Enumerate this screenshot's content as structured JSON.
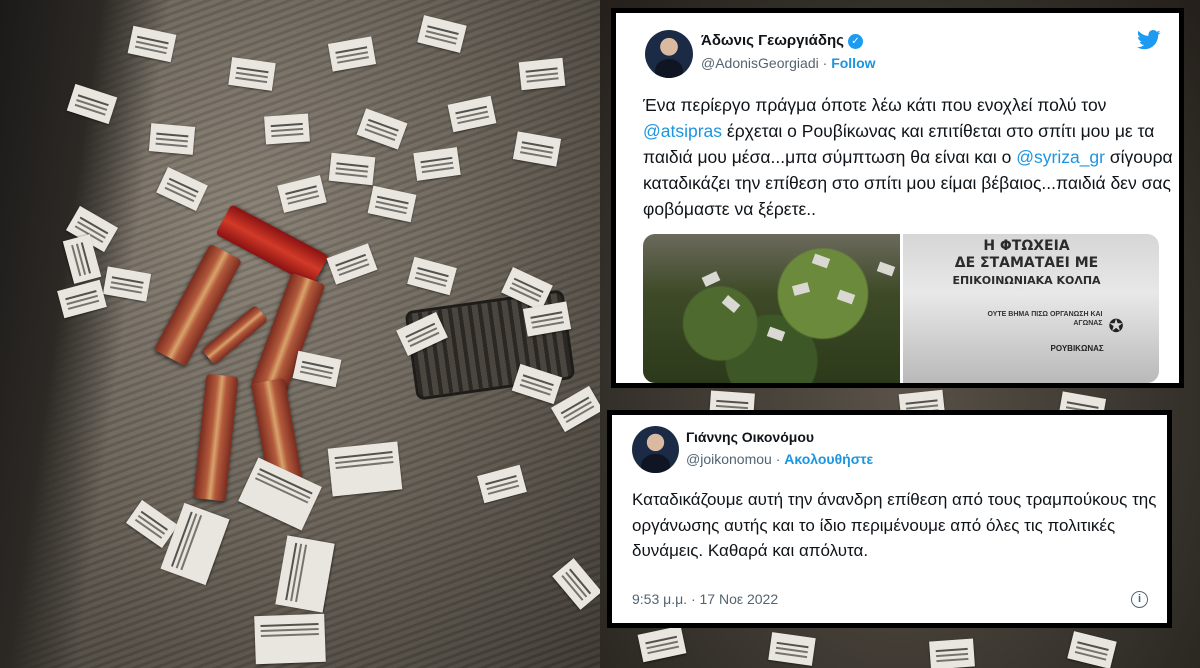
{
  "tweet_1": {
    "author_name": "Άδωνις Γεωργιάδης",
    "handle": "@AdonisGeorgiadi",
    "separator": "·",
    "follow_label": "Follow",
    "text_parts": {
      "p1": "Ένα περίεργο πράγμα όποτε λέω κάτι που ενοχλεί πολύ τον ",
      "m1": "@atsipras",
      "p2": " έρχεται ο Ρουβίκωνας και επιτίθεται στο σπίτι μου με τα παιδιά μου μέσα...μπα σύμπτωση θα είναι και ο ",
      "m2": "@syriza_gr",
      "p3": " σίγουρα καταδικάζει την επίθεση στο σπίτι μου είμαι βέβαιος...παιδιά δεν σας φοβόμαστε να ξέρετε.."
    },
    "icons": [
      "verified-badge-icon",
      "twitter-bird-icon"
    ],
    "poster": {
      "line1": "Η ΦΤΩΧΕΙΑ",
      "line2": "ΔΕ ΣΤΑΜΑΤΑΕΙ ΜΕ",
      "line3": "ΕΠΙΚΟΙΝΩΝΙΑΚΑ ΚΟΛΠΑ",
      "sub": "ΟΥΤΕ ΒΗΜΑ ΠΙΣΩ ΟΡΓΑΝΩΣΗ ΚΑΙ ΑΓΩΝΑΣ",
      "sign": "ΡΟΥΒΙΚΩΝΑΣ"
    }
  },
  "tweet_2": {
    "author_name": "Γιάννης Οικονόμου",
    "handle": "@joikonomou",
    "separator": "·",
    "follow_label": "Ακολουθήστε",
    "text": "Καταδικάζουμε αυτή την άνανδρη επίθεση από τους τραμπούκους της οργάνωσης αυτής και το ίδιο περιμένουμε από όλες τις πολιτικές δυνάμεις. Καθαρά και απόλυτα.",
    "timestamp": "9:53 μ.μ. · 17 Νοε 2022",
    "icons": [
      "info-icon"
    ]
  },
  "colors": {
    "link_blue": "#1b95e0",
    "text_dark": "#0f1419",
    "text_grey": "#536471",
    "twitter_blue": "#1d9bf0"
  }
}
